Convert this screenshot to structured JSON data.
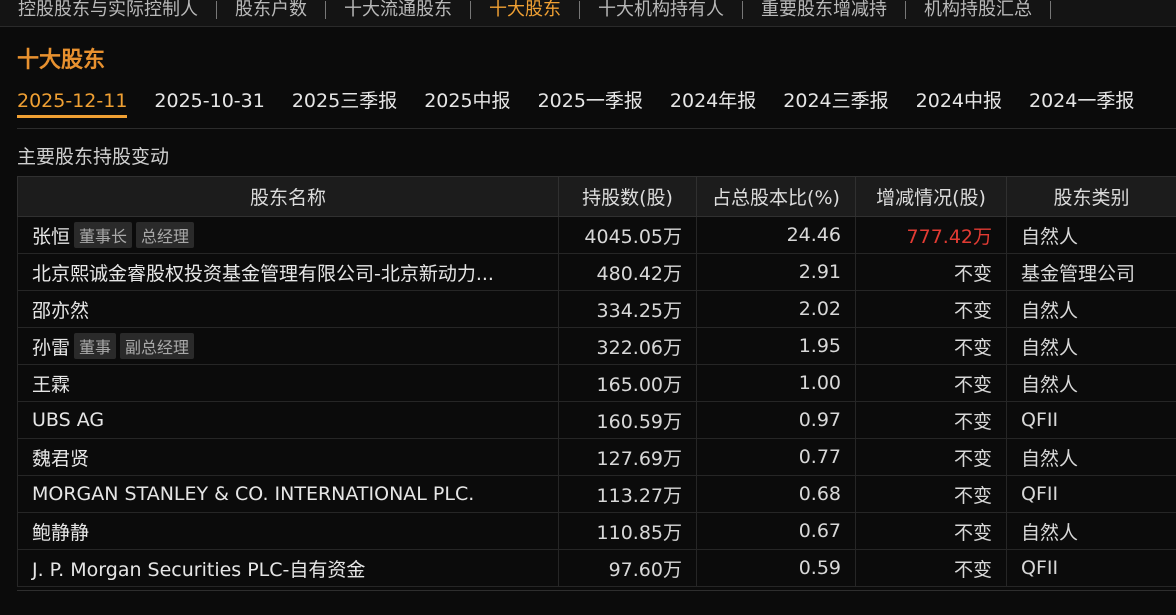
{
  "top_nav": [
    "控股股东与实际控制人",
    "股东户数",
    "十大流通股东",
    "十大股东",
    "十大机构持有人",
    "重要股东增减持",
    "机构持股汇总"
  ],
  "top_nav_active": 3,
  "section_title": "十大股东",
  "periods": [
    "2025-12-11",
    "2025-10-31",
    "2025三季报",
    "2025中报",
    "2025一季报",
    "2024年报",
    "2024三季报",
    "2024中报",
    "2024一季报"
  ],
  "active_period": 0,
  "subtitle": "主要股东持股变动",
  "columns": [
    "股东名称",
    "持股数(股)",
    "占总股本比(%)",
    "增减情况(股)",
    "股东类别"
  ],
  "rows": [
    {
      "name": "张恒",
      "tags": [
        "董事长",
        "总经理"
      ],
      "shares": "4045.05万",
      "ratio": "24.46",
      "change": "777.42万",
      "change_up": true,
      "type": "自然人"
    },
    {
      "name": "北京熙诚金睿股权投资基金管理有限公司-北京新动力...",
      "tags": [],
      "shares": "480.42万",
      "ratio": "2.91",
      "change": "不变",
      "change_up": false,
      "type": "基金管理公司"
    },
    {
      "name": "邵亦然",
      "tags": [],
      "shares": "334.25万",
      "ratio": "2.02",
      "change": "不变",
      "change_up": false,
      "type": "自然人"
    },
    {
      "name": "孙雷",
      "tags": [
        "董事",
        "副总经理"
      ],
      "shares": "322.06万",
      "ratio": "1.95",
      "change": "不变",
      "change_up": false,
      "type": "自然人"
    },
    {
      "name": "王霖",
      "tags": [],
      "shares": "165.00万",
      "ratio": "1.00",
      "change": "不变",
      "change_up": false,
      "type": "自然人"
    },
    {
      "name": "UBS AG",
      "tags": [],
      "shares": "160.59万",
      "ratio": "0.97",
      "change": "不变",
      "change_up": false,
      "type": "QFII"
    },
    {
      "name": "魏君贤",
      "tags": [],
      "shares": "127.69万",
      "ratio": "0.77",
      "change": "不变",
      "change_up": false,
      "type": "自然人"
    },
    {
      "name": "MORGAN STANLEY & CO. INTERNATIONAL PLC.",
      "tags": [],
      "shares": "113.27万",
      "ratio": "0.68",
      "change": "不变",
      "change_up": false,
      "type": "QFII"
    },
    {
      "name": "鲍静静",
      "tags": [],
      "shares": "110.85万",
      "ratio": "0.67",
      "change": "不变",
      "change_up": false,
      "type": "自然人"
    },
    {
      "name": "J. P. Morgan Securities PLC-自有资金",
      "tags": [],
      "shares": "97.60万",
      "ratio": "0.59",
      "change": "不变",
      "change_up": false,
      "type": "QFII"
    }
  ],
  "colors": {
    "accent": "#f0a033",
    "up": "#e23b33",
    "background": "#0b0b0b"
  }
}
